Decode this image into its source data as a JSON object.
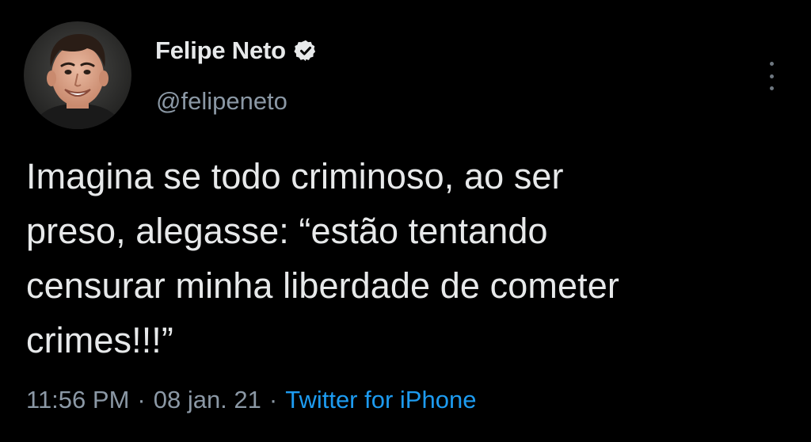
{
  "tweet": {
    "author": {
      "display_name": "Felipe Neto",
      "handle": "@felipeneto",
      "verified": true,
      "avatar_icon": "profile-photo-avatar"
    },
    "text_lines": [
      "Imagina se todo criminoso, ao ser",
      "preso, alegasse: “estão tentando",
      "censurar minha liberdade de cometer",
      "crimes!!!”"
    ],
    "time": "11:56 PM",
    "separator": "·",
    "date": "08 jan. 21",
    "source": "Twitter for iPhone"
  },
  "colors": {
    "background": "#000000",
    "primary_text": "#e7e9ea",
    "secondary_text": "#8b98a5",
    "link": "#1d9bf0",
    "more_icon": "#6e7780"
  },
  "icons": {
    "verified": "verified-badge-icon",
    "more": "more-vertical-icon"
  }
}
